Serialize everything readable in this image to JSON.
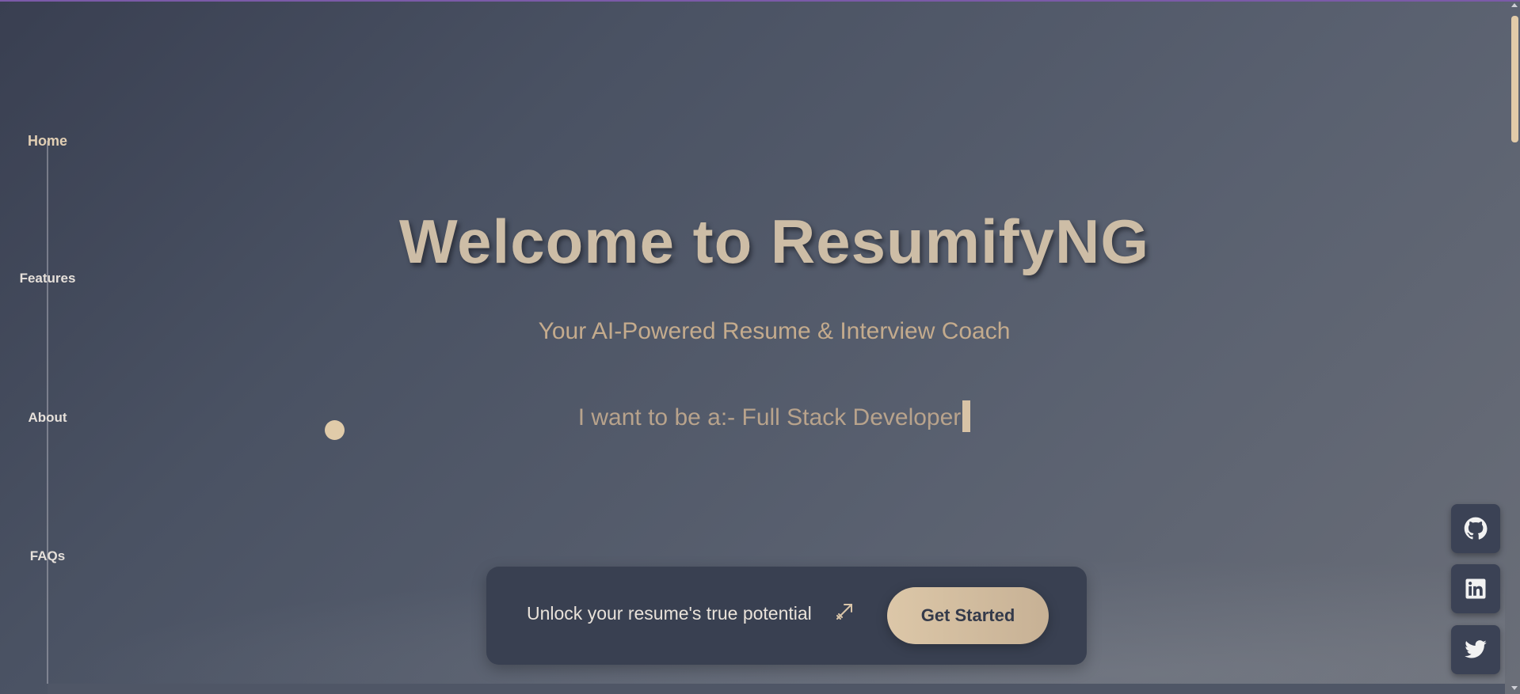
{
  "nav": {
    "items": [
      {
        "label": "Home",
        "active": true
      },
      {
        "label": "Features",
        "active": false
      },
      {
        "label": "About",
        "active": false
      },
      {
        "label": "FAQs",
        "active": false
      }
    ]
  },
  "hero": {
    "title": "Welcome to ResumifyNG",
    "subtitle": "Your AI-Powered Resume & Interview Coach",
    "typing_text": "I want to be a:- Full Stack Developer"
  },
  "cta": {
    "text": "Unlock your resume's true potential",
    "icon": "arrow-target-icon",
    "button_label": "Get Started"
  },
  "social": [
    {
      "name": "github-icon"
    },
    {
      "name": "linkedin-icon"
    },
    {
      "name": "twitter-icon"
    }
  ],
  "colors": {
    "accent": "#dcc7a8",
    "panel": "#394051",
    "title": "#cdbda6"
  }
}
